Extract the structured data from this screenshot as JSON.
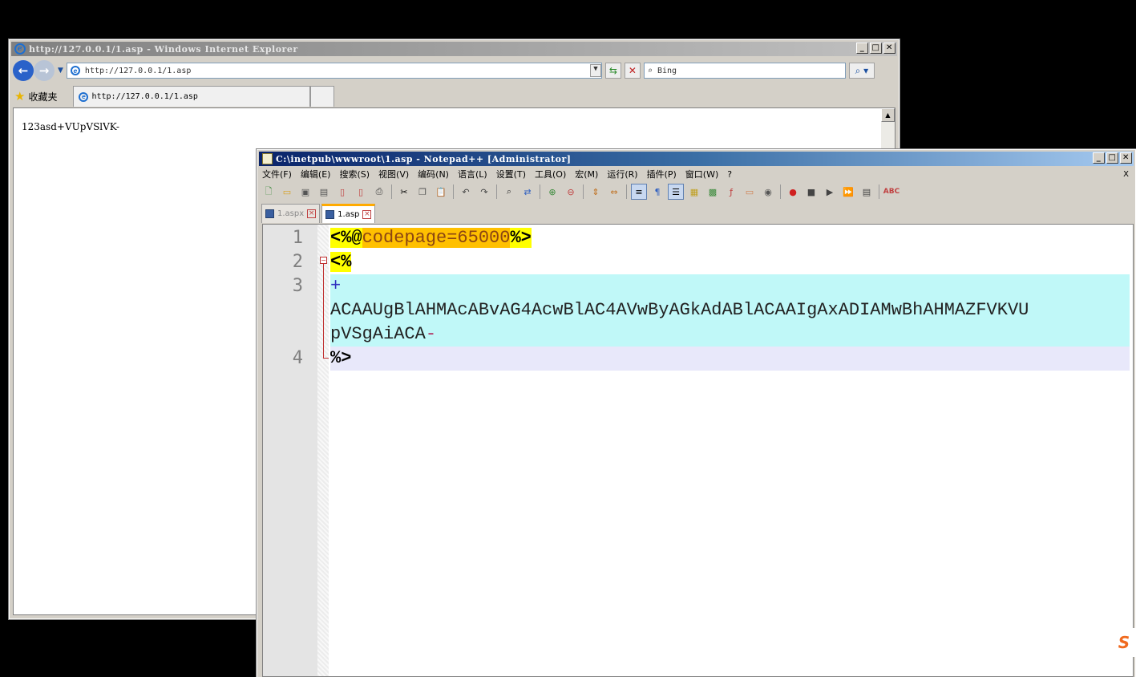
{
  "ie": {
    "title": "http://127.0.0.1/1.asp - Windows Internet Explorer",
    "address": "http://127.0.0.1/1.asp",
    "search_placeholder": "Bing",
    "favorites_label": "收藏夹",
    "tab_label": "http://127.0.0.1/1.asp",
    "page_text": "123asd+VUpVSlVK-",
    "window_buttons": [
      "_",
      "□",
      "✕"
    ]
  },
  "npp": {
    "title": "C:\\inetpub\\wwwroot\\1.asp - Notepad++ [Administrator]",
    "menu": [
      "文件(F)",
      "编辑(E)",
      "搜索(S)",
      "视图(V)",
      "编码(N)",
      "语言(L)",
      "设置(T)",
      "工具(O)",
      "宏(M)",
      "运行(R)",
      "插件(P)",
      "窗口(W)",
      "?"
    ],
    "menu_close": "X",
    "tabs": [
      {
        "label": "1.aspx",
        "active": false
      },
      {
        "label": "1.asp",
        "active": true
      }
    ],
    "line_numbers": [
      "1",
      "2",
      "3",
      "4"
    ],
    "code": {
      "l1_open": "<%@",
      "l1_attr": "codepage=65000",
      "l1_close": "%>",
      "l2": "<%",
      "l3a": "+",
      "l3b": "ACAAUgBlAHMAcABvAG4AcwBlAC4AVwByAGkAdABlACAAIgAxADIAMwBhAHMAZFVKVU",
      "l3c": "pVSgAiACA",
      "l3c_tail": "-",
      "l4": "%>"
    },
    "colors": {
      "caret_line": "#e8e8fa",
      "utf7_block": "#c0f8f8",
      "tag_bg": "#ffff00",
      "attr_bg": "#ffc000"
    }
  },
  "tray": {
    "ime_icon": "S"
  }
}
